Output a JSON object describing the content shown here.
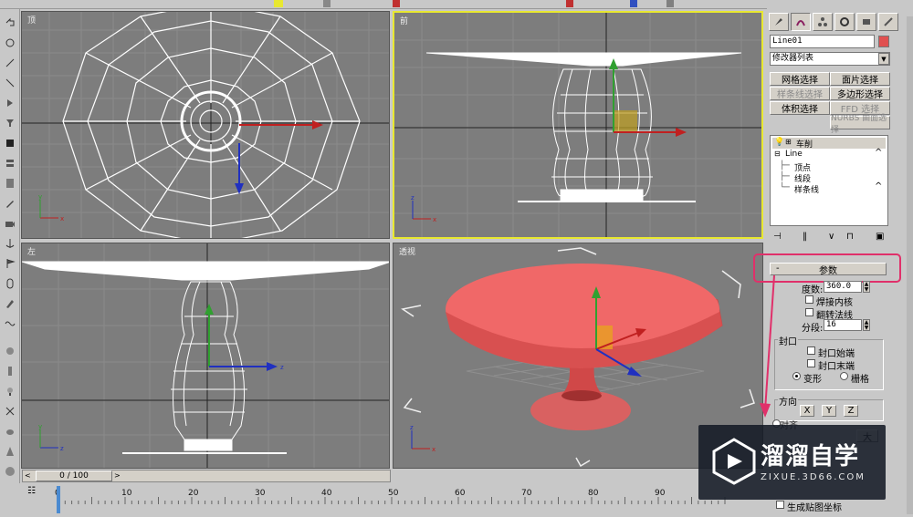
{
  "viewports": {
    "top": {
      "label": "顶"
    },
    "front": {
      "label": "前"
    },
    "left": {
      "label": "左"
    },
    "perspective": {
      "label": "透视"
    }
  },
  "axes": {
    "x": "x",
    "y": "y",
    "z": "z"
  },
  "right_panel": {
    "object_name": "Line01",
    "object_color": "#e05050",
    "modifier_list": "修改器列表",
    "buttons": {
      "mesh_select": "网格选择",
      "patch_select": "面片选择",
      "spline_select": "样条线选择",
      "poly_select": "多边形选择",
      "volume_select": "体积选择",
      "ffd_select": "FFD 选择",
      "nurbs_select": "NURBS 曲面选择"
    },
    "stack": {
      "lathe": "车削",
      "line": "Line",
      "vertex": "顶点",
      "segment": "线段",
      "spline": "样条线"
    },
    "rollout_title": "参数",
    "degrees_label": "度数:",
    "degrees_value": "360.0",
    "weld_core": "焊接内核",
    "flip_normals": "翻转法线",
    "segments_label": "分段:",
    "segments_value": "16",
    "cap_group": "封口",
    "cap_start": "封口始端",
    "cap_end": "封口末端",
    "morph": "变形",
    "grid": "栅格",
    "direction_group": "方向",
    "dir_x": "X",
    "dir_y": "Y",
    "dir_z": "Z",
    "align_partial": "对齐",
    "big_partial": "大",
    "gen_mapping": "生成贴图坐标",
    "highlight_color": "#e0306a"
  },
  "timeline": {
    "frame_counter": "0 / 100",
    "ticks": [
      "0",
      "10",
      "20",
      "30",
      "40",
      "50",
      "60",
      "70",
      "80",
      "90"
    ],
    "frame_value": 0
  },
  "watermark": {
    "brand": "溜溜自学",
    "url": "ZIXUE.3D66.COM"
  }
}
